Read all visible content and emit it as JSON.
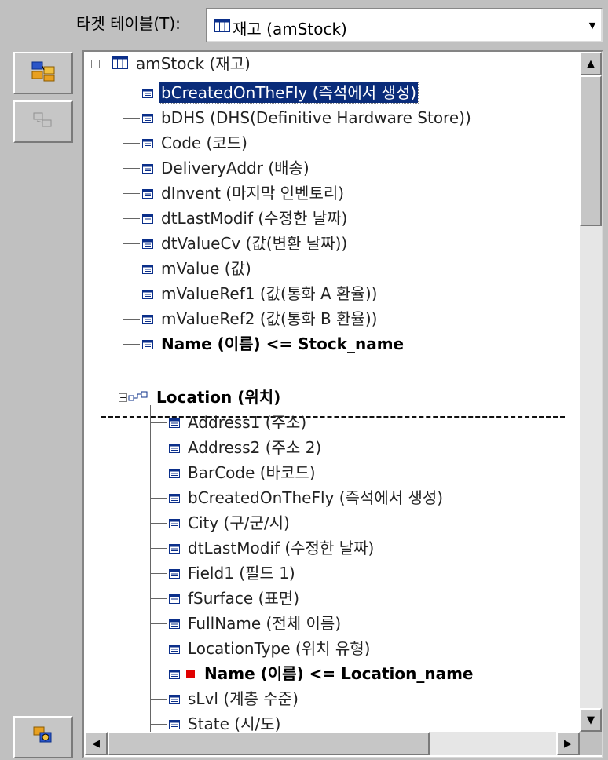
{
  "target_table": {
    "label": "타겟 테이블(T):",
    "value": "재고 (amStock)",
    "table_icon": "table-icon"
  },
  "toolbar": {
    "icons": [
      "map-fields-icon",
      "unmap-fields-icon",
      "settings-icon"
    ]
  },
  "tree": {
    "root": "amStock (재고)",
    "stock_fields": [
      "bCreatedOnTheFly (즉석에서 생성)",
      "bDHS (DHS(Definitive Hardware Store))",
      "Code (코드)",
      "DeliveryAddr (배송)",
      "dInvent (마지막 인벤토리)",
      "dtLastModif (수정한 날짜)",
      "dtValueCv (값(변환 날짜))",
      "mValue (값)",
      "mValueRef1 (값(통화 A 환율))",
      "mValueRef2 (값(통화 B 환율))"
    ],
    "stock_mapped": "Name (이름)  <=  Stock_name",
    "location_link": "Location (위치)",
    "location_fields": [
      "Address1 (주소)",
      "Address2 (주소 2)",
      "BarCode (바코드)",
      "bCreatedOnTheFly (즉석에서 생성)",
      "City (구/군/시)",
      "dtLastModif (수정한 날짜)",
      "Field1 (필드 1)",
      "fSurface (표면)",
      "FullName (전체 이름)",
      "LocationType (위치 유형)"
    ],
    "location_mapped": "Name (이름)  <=  Location_name",
    "location_after": [
      "sLvl (계층 수준)",
      "State (시/도)"
    ],
    "selected_index": 0,
    "mapped_marker_color": "#e00000",
    "selection_color": "#0a2c7a"
  }
}
